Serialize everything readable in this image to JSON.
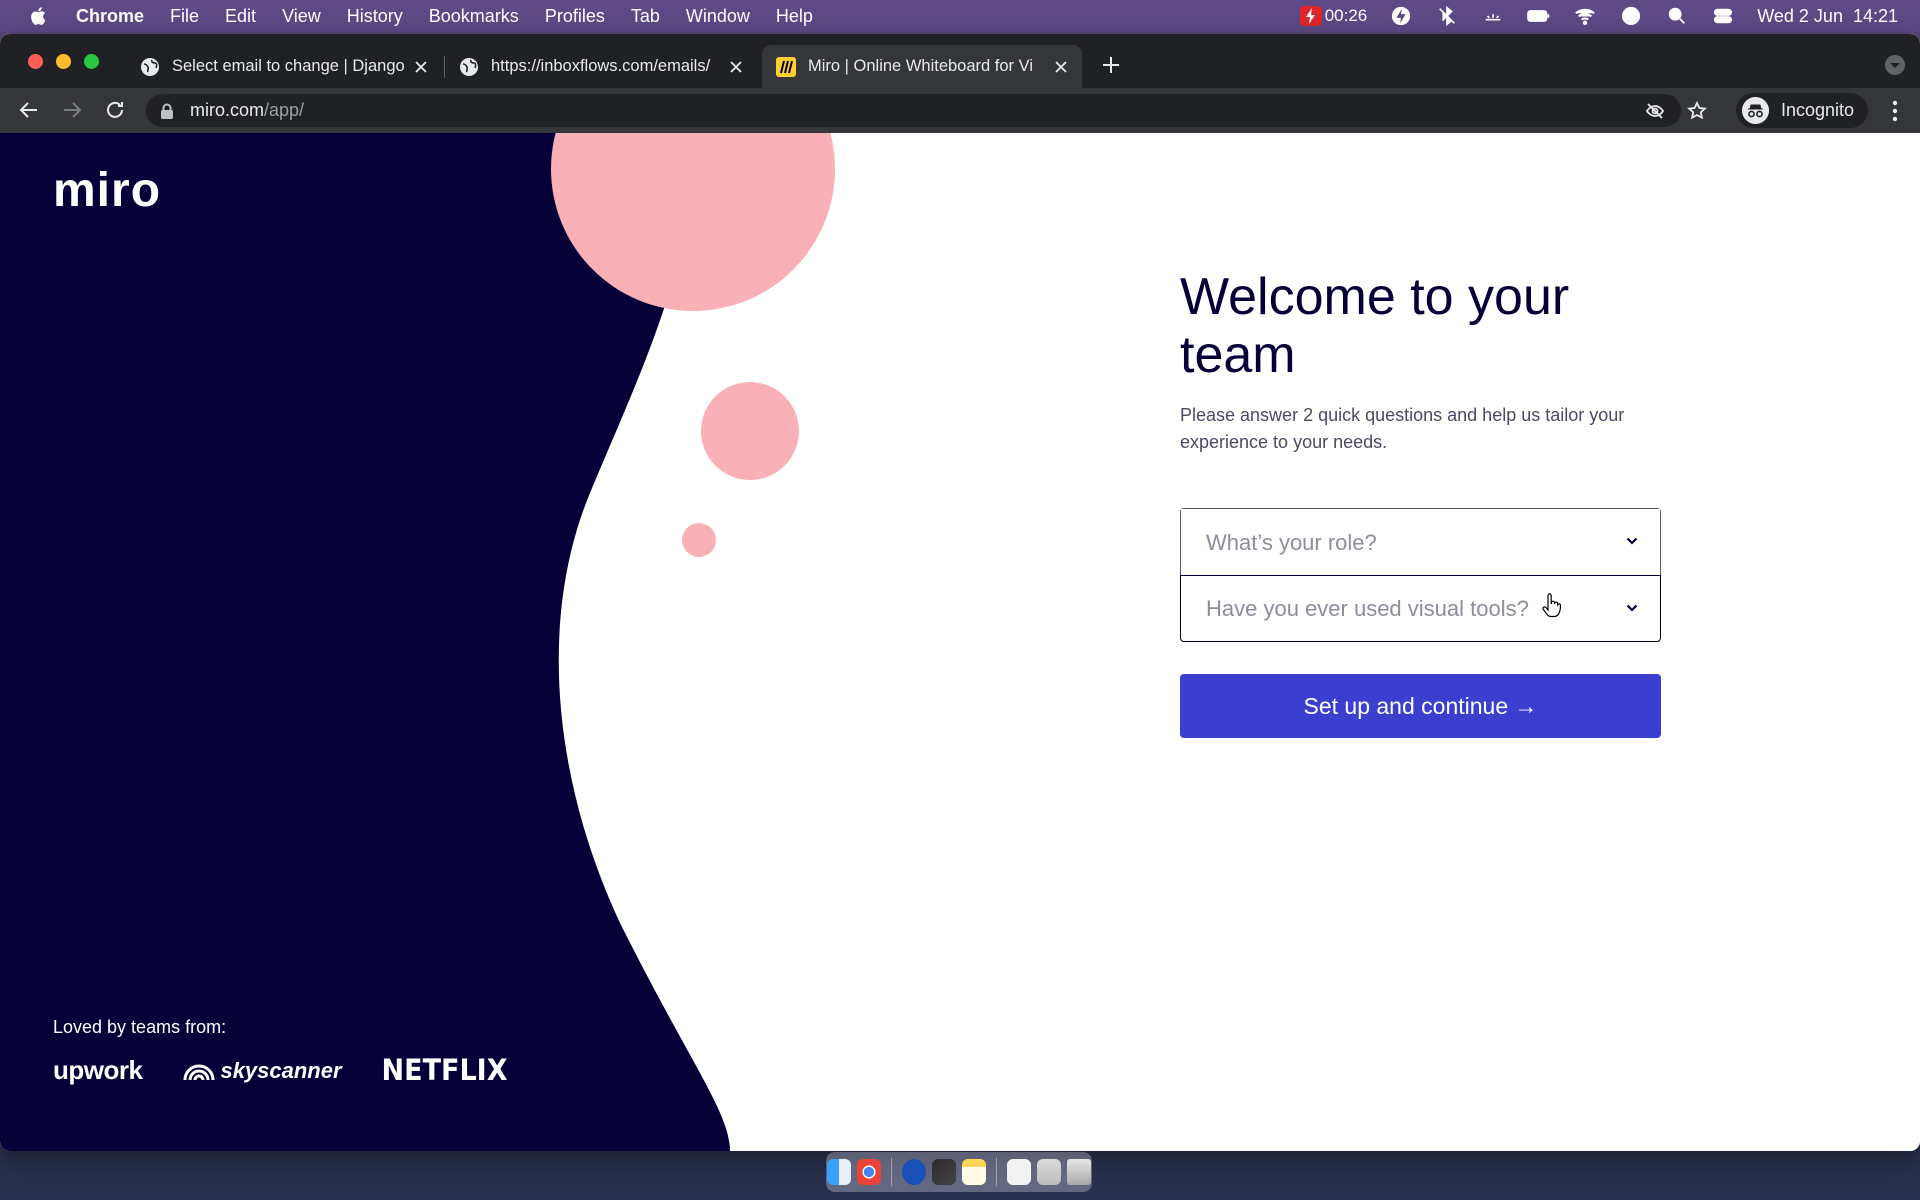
{
  "menubar": {
    "app": "Chrome",
    "items": [
      "File",
      "Edit",
      "View",
      "History",
      "Bookmarks",
      "Profiles",
      "Tab",
      "Window",
      "Help"
    ],
    "recording_time": "00:26",
    "clock": "Wed 2 Jun  14:21"
  },
  "tabs": [
    {
      "title": "Select email to change | Django",
      "active": false
    },
    {
      "title": "https://inboxflows.com/emails/",
      "active": false
    },
    {
      "title": "Miro | Online Whiteboard for Vi",
      "active": true
    }
  ],
  "omnibox": {
    "host": "miro.com",
    "path": "/app/"
  },
  "profile": {
    "label": "Incognito"
  },
  "page": {
    "logo": "miro",
    "heading": "Welcome to your team",
    "subtitle": "Please answer 2 quick questions and help us tailor your experience to your needs.",
    "role_placeholder": "What’s your role?",
    "tools_placeholder": "Have you ever used visual tools?",
    "cta_label": "Set up and continue →",
    "loved_by": "Loved by teams from:",
    "brands": {
      "upwork": "upwork",
      "skyscanner": "skyscanner",
      "netflix": "NETFLIX"
    }
  },
  "colors": {
    "navy": "#050038",
    "pink": "#f9b0b7",
    "cta": "#3b3fd0"
  }
}
